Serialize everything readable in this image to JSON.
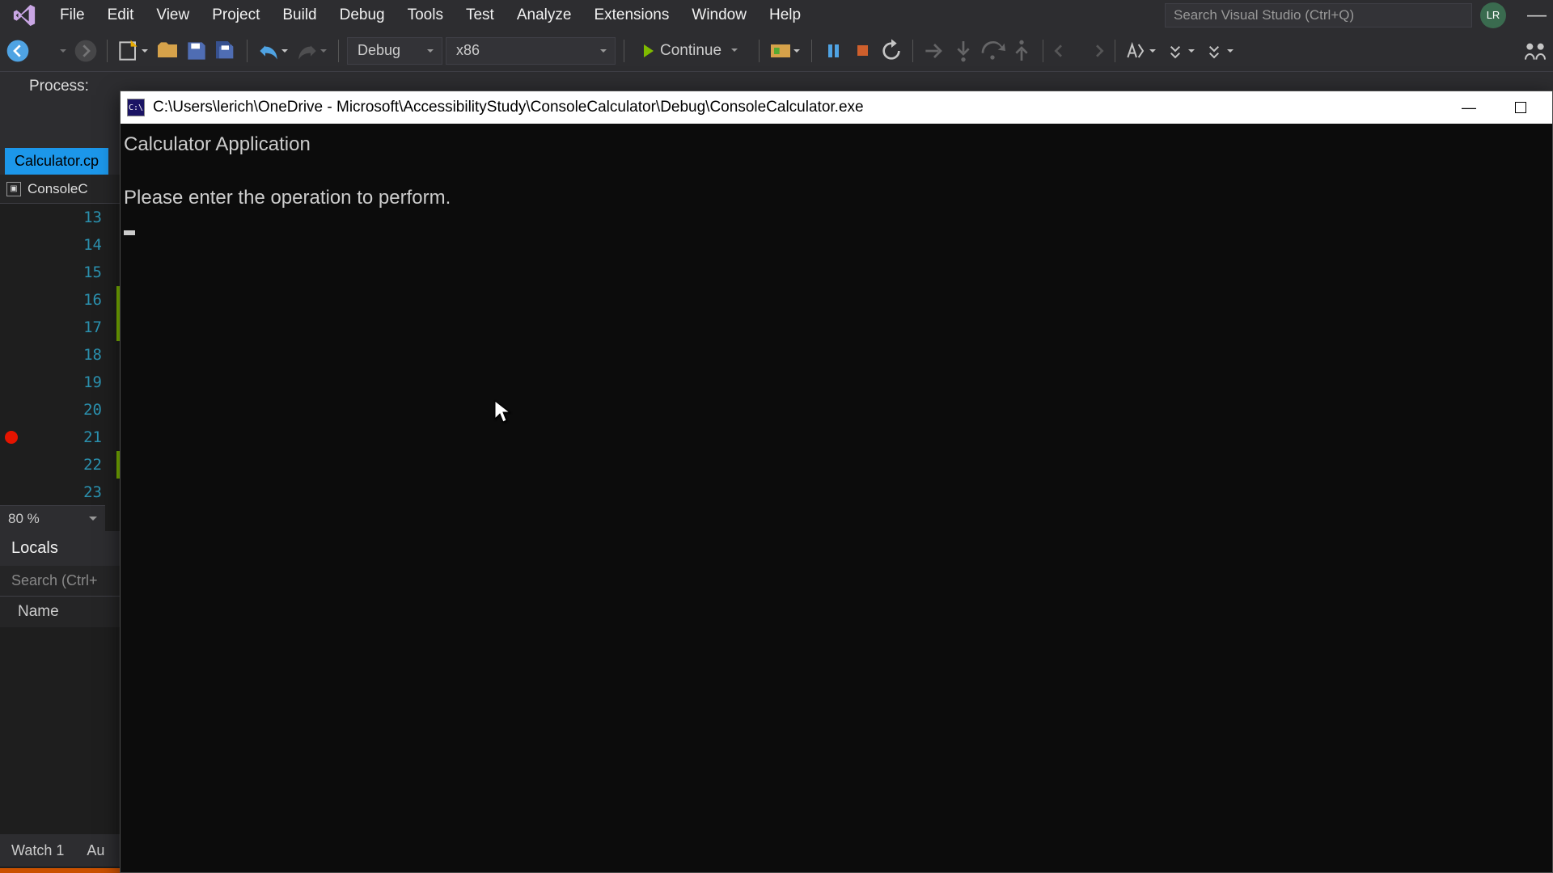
{
  "menu": {
    "items": [
      "File",
      "Edit",
      "View",
      "Project",
      "Build",
      "Debug",
      "Tools",
      "Test",
      "Analyze",
      "Extensions",
      "Window",
      "Help"
    ]
  },
  "search": {
    "placeholder": "Search Visual Studio (Ctrl+Q)"
  },
  "user": {
    "initials": "LR"
  },
  "toolbar": {
    "config": "Debug",
    "platform": "x86",
    "continue": "Continue"
  },
  "processrow": {
    "label": "Process:"
  },
  "filetab": {
    "name": "Calculator.cp"
  },
  "context": {
    "project": "ConsoleC"
  },
  "lines": {
    "numbers": [
      13,
      14,
      15,
      16,
      17,
      18,
      19,
      20,
      21,
      22,
      23
    ],
    "breakpoint_at": 21,
    "modified": [
      16,
      17,
      22
    ]
  },
  "zoom": {
    "value": "80 %"
  },
  "locals": {
    "title": "Locals",
    "search_placeholder": "Search (Ctrl+",
    "col_name": "Name"
  },
  "bottom_tabs": {
    "watch": "Watch 1",
    "autos": "Au"
  },
  "console": {
    "path": "C:\\Users\\lerich\\OneDrive - Microsoft\\AccessibilityStudy\\ConsoleCalculator\\Debug\\ConsoleCalculator.exe",
    "line1": "Calculator Application",
    "line2": "Please enter the operation to perform."
  }
}
